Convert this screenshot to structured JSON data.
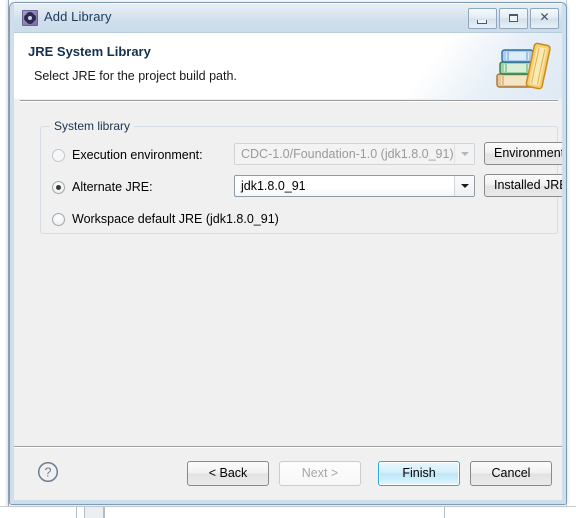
{
  "window": {
    "title": "Add Library",
    "icon": "gear-icon",
    "controls": {
      "minimize": "minimize-icon",
      "maximize": "maximize-icon",
      "close": "close-icon",
      "close_glyph": "✕"
    }
  },
  "header": {
    "title": "JRE System Library",
    "subtitle": "Select JRE for the project build path.",
    "icon": "books-icon"
  },
  "group": {
    "label": "System library",
    "options": [
      {
        "id": "execution-environment",
        "label": "Execution environment:",
        "selected": false,
        "enabled": false,
        "combo_value": "CDC-1.0/Foundation-1.0 (jdk1.8.0_91)",
        "button_label": "Environments..."
      },
      {
        "id": "alternate-jre",
        "label": "Alternate JRE:",
        "selected": true,
        "enabled": true,
        "combo_value": "jdk1.8.0_91",
        "button_label": "Installed JREs..."
      },
      {
        "id": "workspace-default-jre",
        "label": "Workspace default JRE (jdk1.8.0_91)",
        "selected": false,
        "enabled": true
      }
    ]
  },
  "footer": {
    "help_icon": "help-icon",
    "help_glyph": "?",
    "buttons": [
      {
        "id": "back",
        "label": "< Back",
        "enabled": true,
        "default": false
      },
      {
        "id": "next",
        "label": "Next >",
        "enabled": false,
        "default": false
      },
      {
        "id": "finish",
        "label": "Finish",
        "enabled": true,
        "default": true
      },
      {
        "id": "cancel",
        "label": "Cancel",
        "enabled": true,
        "default": false
      }
    ]
  },
  "colors": {
    "titlebar": "#cfdeeb",
    "dialog_bg": "#f0f0f0",
    "header_bg": "#ffffff",
    "accent_default_button": "#2aa8e0",
    "title_text": "#1b3a5c"
  }
}
